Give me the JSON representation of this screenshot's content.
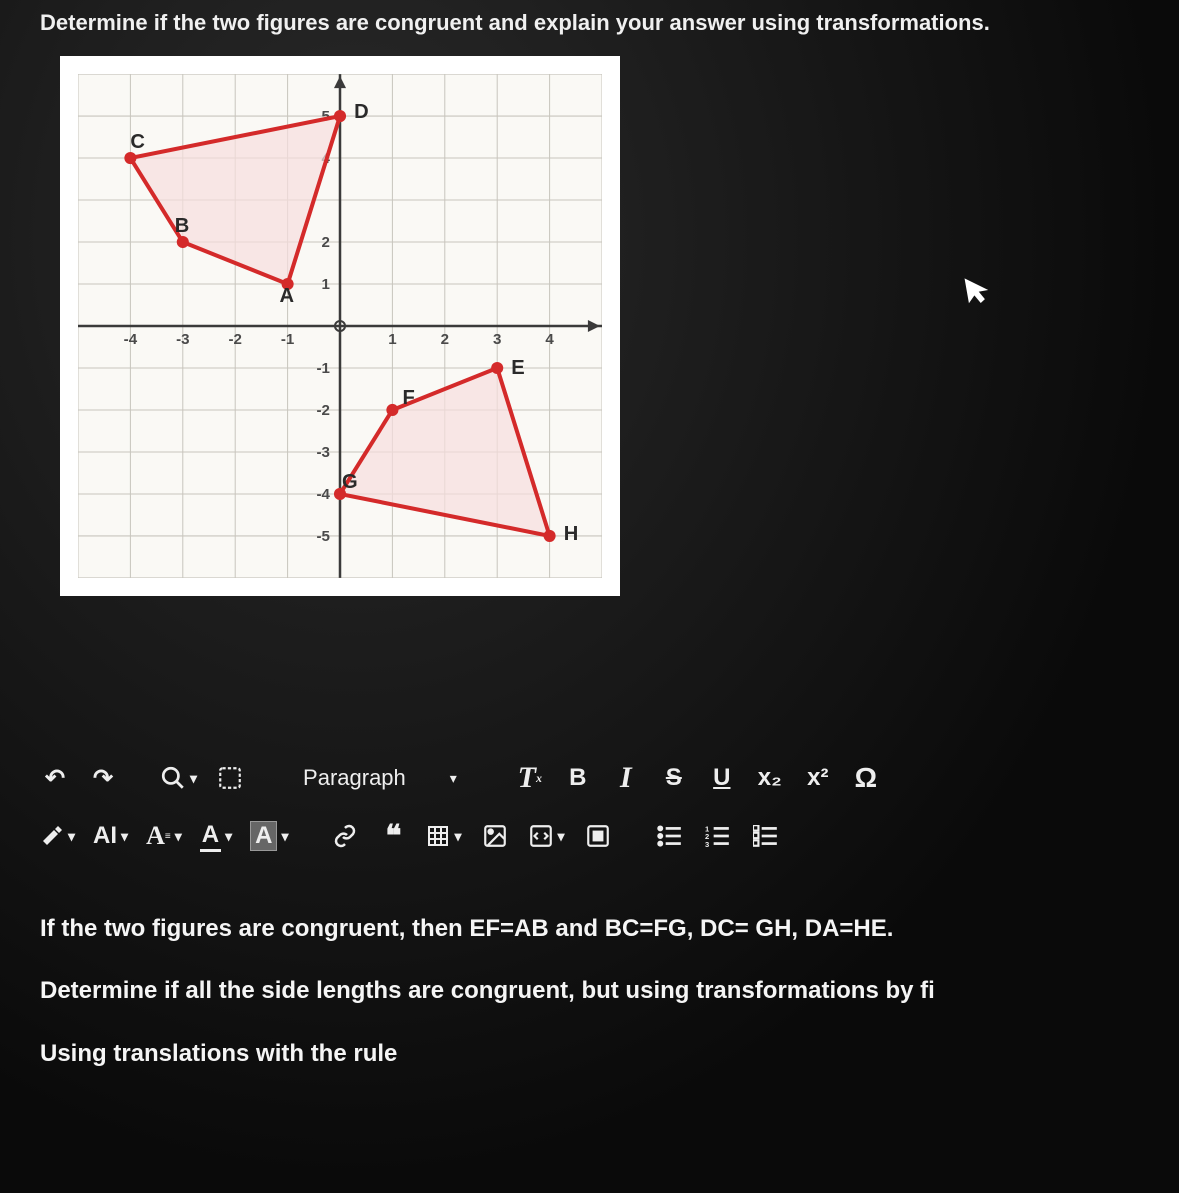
{
  "question": "Determine if the two figures are congruent and explain your answer using transformations.",
  "chart_data": {
    "type": "scatter",
    "title": "",
    "xlabel": "",
    "ylabel": "",
    "xlim": [
      -5,
      5
    ],
    "ylim": [
      -6,
      6
    ],
    "x_ticks": [
      -4,
      -3,
      -2,
      -1,
      1,
      2,
      3,
      4
    ],
    "y_ticks": [
      -5,
      -4,
      -3,
      -2,
      -1,
      1,
      2,
      4,
      5
    ],
    "shapes": [
      {
        "name": "ABCD",
        "fill": "#f7dede",
        "stroke": "#d42a2a",
        "points": [
          {
            "label": "A",
            "x": -1,
            "y": 1
          },
          {
            "label": "B",
            "x": -3,
            "y": 2
          },
          {
            "label": "C",
            "x": -4,
            "y": 4
          },
          {
            "label": "D",
            "x": 0,
            "y": 5
          }
        ]
      },
      {
        "name": "EFGH",
        "fill": "#f7dede",
        "stroke": "#d42a2a",
        "points": [
          {
            "label": "E",
            "x": 3,
            "y": -1
          },
          {
            "label": "F",
            "x": 1,
            "y": -2
          },
          {
            "label": "G",
            "x": 0,
            "y": -4
          },
          {
            "label": "H",
            "x": 4,
            "y": -5
          }
        ]
      }
    ]
  },
  "toolbar": {
    "undo": "↶",
    "redo": "↷",
    "zoom": "⤢",
    "fullscreen": "⛶",
    "block_label": "Paragraph",
    "clear_format": "T",
    "clear_sub": "x",
    "bold": "B",
    "italic": "I",
    "strike": "S",
    "underline": "U",
    "subscript": "x₂",
    "superscript": "x²",
    "omega": "Ω",
    "pen": "✎",
    "ai": "AI",
    "fontfam": "A",
    "fontcolor": "A",
    "highlight": "A",
    "link": "🔗",
    "quote": "❝",
    "table": "▦",
    "image": "🖼",
    "code": "⎘",
    "media": "▣",
    "ul": "⋮≡",
    "ol": "1≡",
    "task": "☑≡"
  },
  "answer": {
    "line1": "If the two figures are congruent, then EF=AB and BC=FG, DC= GH, DA=HE.",
    "line2": "Determine if all the side lengths are congruent, but using transformations by fi",
    "line3": "Using translations with the rule"
  }
}
